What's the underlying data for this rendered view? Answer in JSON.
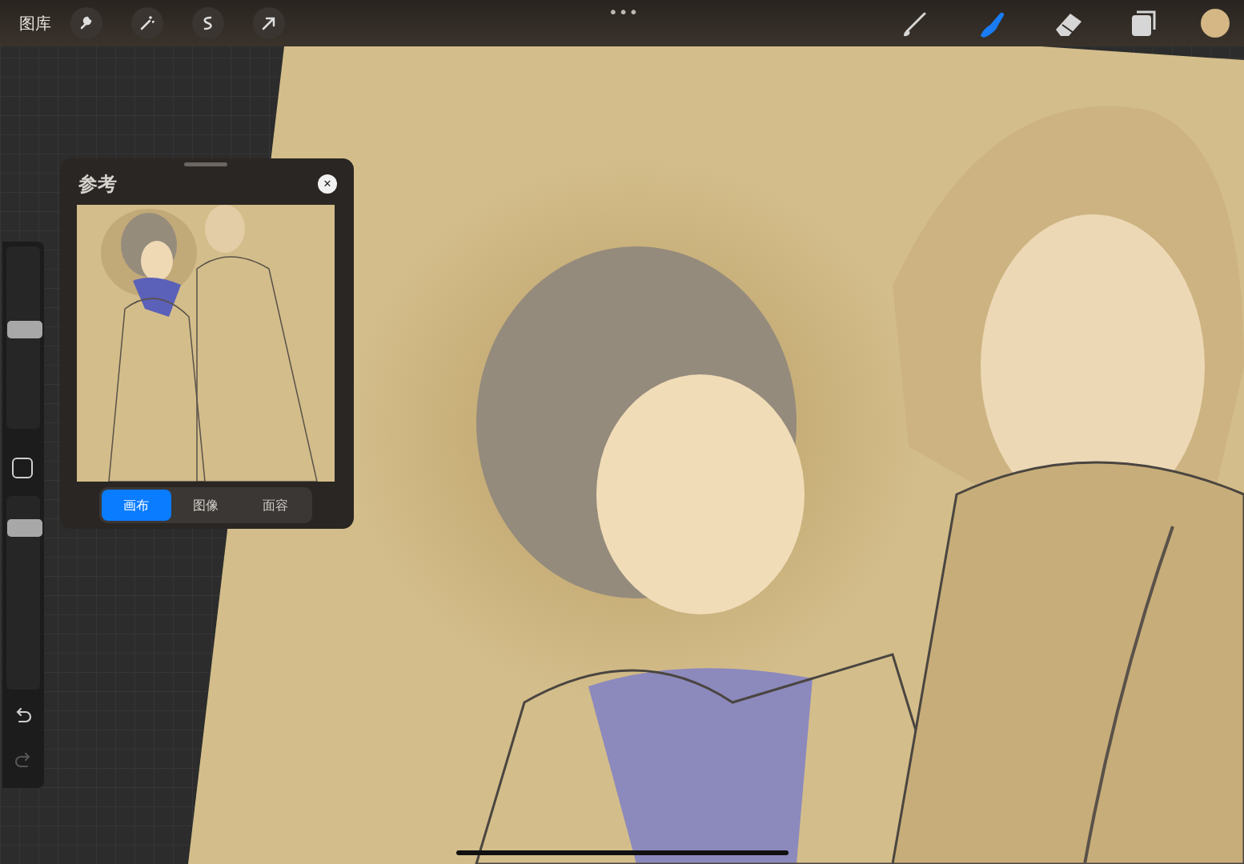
{
  "toolbar": {
    "gallery": "图库",
    "more": "•••",
    "left_tools": [
      {
        "kind": "wrench"
      },
      {
        "kind": "wand"
      },
      {
        "kind": "select"
      },
      {
        "kind": "move"
      }
    ],
    "right_tools": [
      {
        "kind": "brush",
        "selected": false
      },
      {
        "kind": "smudge",
        "selected": true
      },
      {
        "kind": "eraser",
        "selected": false
      },
      {
        "kind": "layers",
        "selected": false
      }
    ],
    "color": "#d4b784"
  },
  "sidebar": {
    "sliders": [
      {
        "level": 0.55
      },
      {
        "level": 0.87
      }
    ],
    "undo": {
      "disabled": false
    },
    "redo": {
      "disabled": true
    }
  },
  "reference_panel": {
    "title": "参考",
    "close": "✕",
    "tabs": [
      {
        "label": "画布",
        "selected": true
      },
      {
        "label": "图像",
        "selected": false
      },
      {
        "label": "面容",
        "selected": false
      }
    ]
  }
}
